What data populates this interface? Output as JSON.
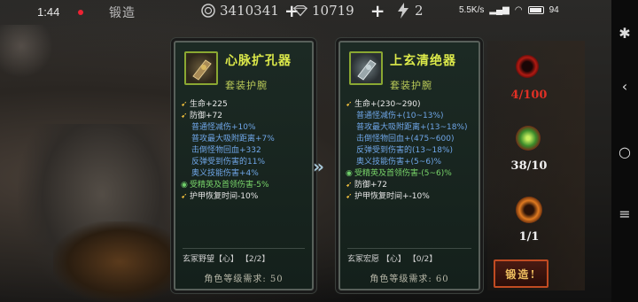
{
  "statusbar": {
    "time": "1:44",
    "title": "锻造",
    "net": "5.5K/s",
    "battery": "94"
  },
  "resources": [
    {
      "icon": "coin-icon",
      "value": "3410341"
    },
    {
      "icon": "gem-icon",
      "value": "10719"
    },
    {
      "icon": "lightning-icon",
      "value": "2"
    }
  ],
  "left_item": {
    "name": "心脉扩孔器",
    "type": "套装护腕",
    "stats": [
      {
        "kind": "main",
        "text": "生命+225"
      },
      {
        "kind": "main",
        "text": "防御+72"
      },
      {
        "kind": "sub",
        "text": "普通怪减伤+10%"
      },
      {
        "kind": "sub",
        "text": "普攻最大吸附距离+7%"
      },
      {
        "kind": "sub",
        "text": "击倒怪物回血+332"
      },
      {
        "kind": "sub",
        "text": "反弹受到伤害的11%"
      },
      {
        "kind": "sub",
        "text": "奥义技能伤害+4%"
      },
      {
        "kind": "set",
        "text": "受精英及首领伤害-5%"
      },
      {
        "kind": "main",
        "text": "护甲恢复时间-10%"
      }
    ],
    "set_info": "玄冢野望【心】 【2/2】",
    "requirement": "角色等级需求: 50"
  },
  "right_item": {
    "name": "上玄清绝器",
    "type": "套装护腕",
    "stats": [
      {
        "kind": "main",
        "text": "生命+(230~290)"
      },
      {
        "kind": "sub",
        "text": "普通怪减伤+(10~13%)"
      },
      {
        "kind": "sub",
        "text": "普攻最大吸附距离+(13~18%)"
      },
      {
        "kind": "sub",
        "text": "击倒怪物回血+(475~600)"
      },
      {
        "kind": "sub",
        "text": "反弹受到伤害的(13~18%)"
      },
      {
        "kind": "sub",
        "text": "奥义技能伤害+(5~6)%"
      },
      {
        "kind": "set",
        "text": "受精英及首领伤害-(5~6)%"
      },
      {
        "kind": "main",
        "text": "防御+72"
      },
      {
        "kind": "main",
        "text": "护甲恢复时间+-10%"
      }
    ],
    "set_info": "玄冢宏愿 【心】 【0/2】",
    "requirement": "角色等级需求: 60"
  },
  "materials": [
    {
      "icon": "red-orb-icon",
      "count": "4/100",
      "color": "#e03025"
    },
    {
      "icon": "green-orb-icon",
      "count": "38/10",
      "color": "#f0f0f0"
    },
    {
      "icon": "fire-ring-icon",
      "count": "1/1",
      "color": "#f0f0f0"
    }
  ],
  "forge_button": "锻造!"
}
